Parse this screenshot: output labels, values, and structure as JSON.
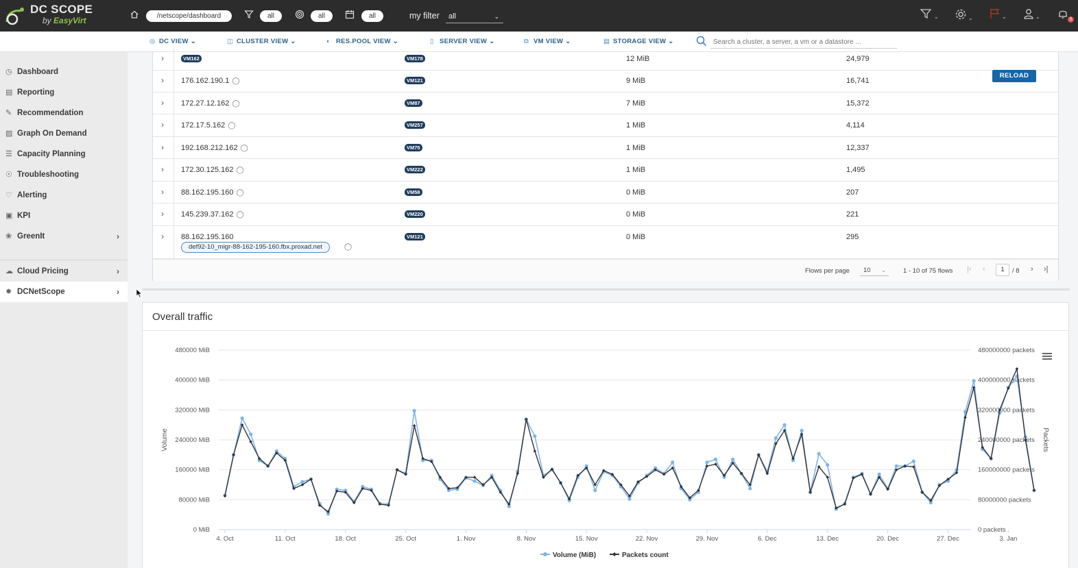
{
  "app": {
    "logo_title": "DC SCOPE",
    "logo_by": "by",
    "logo_brand": "EasyVirt"
  },
  "topbar": {
    "path": "/netscope/dashboard",
    "filter_pill": "all",
    "target_pill": "all",
    "calendar_pill": "all",
    "myfilter_label": "my filter",
    "myfilter_value": "all",
    "notification_count": "0"
  },
  "nav": {
    "items": [
      "DC VIEW",
      "CLUSTER VIEW",
      "RES.POOL VIEW",
      "SERVER VIEW",
      "VM VIEW",
      "STORAGE VIEW"
    ],
    "search_placeholder": "Search a cluster, a server, a vm or a datastore ..."
  },
  "sidebar": {
    "items": [
      {
        "label": "Dashboard",
        "icon": "dashboard-icon"
      },
      {
        "label": "Reporting",
        "icon": "reporting-icon"
      },
      {
        "label": "Recommendation",
        "icon": "recommendation-icon"
      },
      {
        "label": "Graph On Demand",
        "icon": "graph-icon"
      },
      {
        "label": "Capacity Planning",
        "icon": "capacity-icon"
      },
      {
        "label": "Troubleshooting",
        "icon": "troubleshooting-icon"
      },
      {
        "label": "Alerting",
        "icon": "bell-icon"
      },
      {
        "label": "KPI",
        "icon": "kpi-icon"
      },
      {
        "label": "GreenIt",
        "icon": "leaf-icon"
      },
      {
        "label": "Cloud Pricing",
        "icon": "cloud-icon"
      },
      {
        "label": "DCNetScope",
        "icon": "network-icon"
      }
    ]
  },
  "flows": {
    "rows": [
      {
        "source": "VM162",
        "destination": "VM178",
        "volume": "12 MiB",
        "packets": "24,979"
      },
      {
        "source": "176.162.190.1",
        "destination": "VM121",
        "volume": "9 MiB",
        "packets": "16,741"
      },
      {
        "source": "172.27.12.162",
        "destination": "VM87",
        "volume": "7 MiB",
        "packets": "15,372"
      },
      {
        "source": "172.17.5.162",
        "destination": "VM257",
        "volume": "1 MiB",
        "packets": "4,114"
      },
      {
        "source": "192.168.212.162",
        "destination": "VM75",
        "volume": "1 MiB",
        "packets": "12,337"
      },
      {
        "source": "172.30.125.162",
        "destination": "VM222",
        "volume": "1 MiB",
        "packets": "1,495"
      },
      {
        "source": "88.162.195.160",
        "destination": "VM58",
        "volume": "0 MiB",
        "packets": "207"
      },
      {
        "source": "145.239.37.162",
        "destination": "VM220",
        "volume": "0 MiB",
        "packets": "221"
      },
      {
        "source": "88.162.195.160",
        "destination": "VM121",
        "volume": "0 MiB",
        "packets": "295",
        "hostname": "def92-10_migr-88-162-195-160.fbx.proxad.net"
      }
    ],
    "reload_label": "RELOAD",
    "pager": {
      "per_page_label": "Flows per page",
      "per_page": "10",
      "range": "1 - 10 of 75 flows",
      "page": "1",
      "total_pages": "/ 8"
    }
  },
  "chart_data": {
    "type": "line",
    "title": "Overall traffic",
    "ylabel": "Volume",
    "y2label": "Packets",
    "ylim": [
      0,
      480000
    ],
    "y2lim": [
      0,
      480000000
    ],
    "y_ticks": [
      "0 MiB",
      "80000 MiB",
      "160000 MiB",
      "240000 MiB",
      "320000 MiB",
      "400000 MiB",
      "480000 MiB"
    ],
    "y2_ticks": [
      "0 packets",
      "80000000 packets",
      "160000000 packets",
      "240000000 packets",
      "320000000 packets",
      "400000000 packets",
      "480000000 packets"
    ],
    "x_ticks": [
      "4. Oct",
      "11. Oct",
      "18. Oct",
      "25. Oct",
      "1. Nov",
      "8. Nov",
      "15. Nov",
      "22. Nov",
      "29. Nov",
      "6. Dec",
      "13. Dec",
      "20. Dec",
      "27. Dec",
      "3. Jan"
    ],
    "legend_position": "bottom-center",
    "series": [
      {
        "name": "Volume (MiB)",
        "color": "#7cb5ec",
        "values": [
          92000,
          200000,
          298000,
          255000,
          185000,
          170000,
          210000,
          190000,
          115000,
          128000,
          135000,
          70000,
          42000,
          108000,
          105000,
          75000,
          115000,
          108000,
          70000,
          68000,
          160000,
          150000,
          318000,
          185000,
          185000,
          135000,
          105000,
          108000,
          138000,
          130000,
          118000,
          145000,
          105000,
          62000,
          155000,
          295000,
          250000,
          145000,
          160000,
          125000,
          78000,
          140000,
          170000,
          105000,
          155000,
          145000,
          115000,
          82000,
          125000,
          145000,
          165000,
          150000,
          180000,
          110000,
          80000,
          100000,
          180000,
          188000,
          140000,
          188000,
          150000,
          110000,
          200000,
          155000,
          245000,
          280000,
          185000,
          265000,
          100000,
          203000,
          173000,
          55000,
          70000,
          140000,
          150000,
          95000,
          148000,
          110000,
          170000,
          170000,
          183000,
          100000,
          72000,
          120000,
          130000,
          160000,
          315000,
          398000,
          215000,
          190000,
          312000,
          380000,
          410000,
          248000,
          105000
        ]
      },
      {
        "name": "Packets count",
        "color": "#333333",
        "values": [
          90000000,
          200000000,
          280000000,
          235000000,
          190000000,
          170000000,
          205000000,
          185000000,
          110000000,
          120000000,
          135000000,
          65000000,
          48000000,
          103000000,
          100000000,
          72000000,
          110000000,
          105000000,
          68000000,
          65000000,
          160000000,
          148000000,
          278000000,
          190000000,
          182000000,
          140000000,
          110000000,
          112000000,
          140000000,
          140000000,
          120000000,
          140000000,
          100000000,
          68000000,
          150000000,
          295000000,
          210000000,
          140000000,
          162000000,
          125000000,
          82000000,
          145000000,
          165000000,
          120000000,
          158000000,
          148000000,
          120000000,
          90000000,
          128000000,
          142000000,
          160000000,
          148000000,
          165000000,
          115000000,
          85000000,
          105000000,
          170000000,
          175000000,
          145000000,
          178000000,
          150000000,
          120000000,
          200000000,
          150000000,
          230000000,
          265000000,
          190000000,
          255000000,
          100000000,
          168000000,
          140000000,
          58000000,
          68000000,
          138000000,
          148000000,
          95000000,
          140000000,
          108000000,
          160000000,
          170000000,
          168000000,
          100000000,
          78000000,
          118000000,
          135000000,
          152000000,
          300000000,
          380000000,
          220000000,
          190000000,
          320000000,
          378000000,
          430000000,
          240000000,
          105000000
        ]
      }
    ]
  }
}
